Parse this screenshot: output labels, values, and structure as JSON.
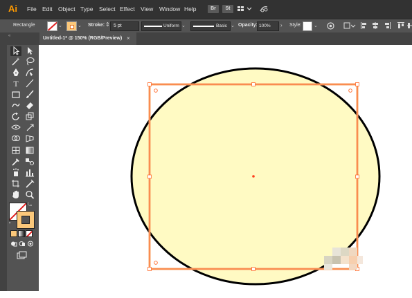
{
  "app": {
    "logo": "Ai"
  },
  "menu": [
    "File",
    "Edit",
    "Object",
    "Type",
    "Select",
    "Effect",
    "View",
    "Window",
    "Help"
  ],
  "menubar_badges": [
    "Br",
    "St"
  ],
  "control": {
    "selection_label": "Rectangle",
    "stroke_label": "Stroke:",
    "stroke_weight": "5 pt",
    "profile_label": "Uniform",
    "brush_label": "Basic",
    "opacity_label": "Opacity:",
    "opacity_value": "100%",
    "style_label": "Style:"
  },
  "document": {
    "tab_title": "Untitled-1* @ 150% (RGB/Preview)",
    "close_glyph": "×"
  },
  "artwork": {
    "ellipse_fill": "#fffac3",
    "ellipse_stroke": "#000000",
    "rect_stroke": "#f7a46b",
    "selection_color": "#ff6600"
  },
  "tools": [
    "selection-tool",
    "direct-selection-tool",
    "magic-wand-tool",
    "lasso-tool",
    "pen-tool",
    "curvature-tool",
    "type-tool",
    "line-tool",
    "rectangle-tool",
    "paintbrush-tool",
    "shaper-tool",
    "eraser-tool",
    "rotate-tool",
    "scale-tool",
    "width-tool",
    "free-transform-tool",
    "shape-builder-tool",
    "perspective-grid-tool",
    "mesh-tool",
    "gradient-tool",
    "eyedropper-tool",
    "blend-tool",
    "symbol-sprayer-tool",
    "column-graph-tool",
    "artboard-tool",
    "slice-tool",
    "hand-tool",
    "zoom-tool"
  ]
}
